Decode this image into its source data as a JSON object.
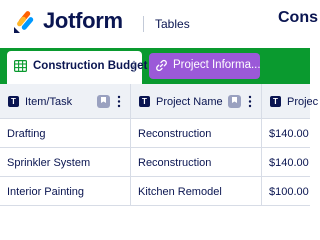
{
  "header": {
    "logo_text": "Jotform",
    "app_name": "Tables",
    "title": "Cons"
  },
  "tabs": [
    {
      "label": "Construction Budget",
      "active": true
    },
    {
      "label": "Project Informa...",
      "active": false
    }
  ],
  "colors": {
    "tabbar_bg": "#0a9a2f",
    "secondary_tab_bg": "#9b59d8",
    "text_primary": "#0a1551",
    "header_row_bg": "#eef1f6"
  },
  "table": {
    "columns": [
      {
        "label": "Item/Task",
        "type_icon": "T"
      },
      {
        "label": "Project Name",
        "type_icon": "T"
      },
      {
        "label": "Projec",
        "type_icon": "T"
      }
    ],
    "rows": [
      [
        "Drafting",
        "Reconstruction",
        "$140.00"
      ],
      [
        "Sprinkler System",
        "Reconstruction",
        "$140.00"
      ],
      [
        "Interior Painting",
        "Kitchen Remodel",
        "$100.00"
      ]
    ]
  }
}
